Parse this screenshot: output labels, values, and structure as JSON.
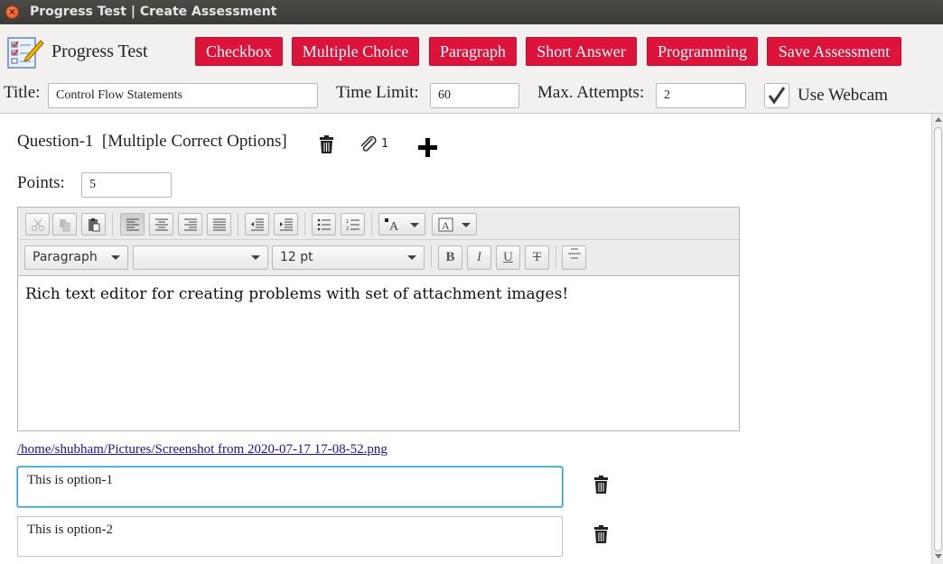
{
  "window": {
    "title": "Progress Test | Create Assessment",
    "close_glyph": "×"
  },
  "header": {
    "app_name": "Progress Test",
    "app_icon": "checklist-pencil-icon",
    "buttons": [
      "Checkbox",
      "Multiple Choice",
      "Paragraph",
      "Short Answer",
      "Programming",
      "Save Assessment"
    ],
    "accent_color": "#dc143c"
  },
  "form": {
    "title_label": "Title:",
    "title_value": "Control Flow Statements",
    "time_limit_label": "Time Limit:",
    "time_limit_value": "60",
    "max_attempts_label": "Max. Attempts:",
    "max_attempts_value": "2",
    "webcam_label": "Use Webcam",
    "webcam_checked": true
  },
  "question": {
    "heading": "Question-1  [Multiple Correct Options]",
    "attachment_count": "1",
    "points_label": "Points:",
    "points_value": "5",
    "editor": {
      "paragraph_style": "Paragraph",
      "font_family": "",
      "font_size": "12 pt",
      "body_text": "Rich text editor for creating problems with set of attachment images!"
    },
    "attachment_path": "/home/shubham/Pictures/Screenshot from 2020-07-17 17-08-52.png",
    "options": [
      {
        "text": "This is option-1"
      },
      {
        "text": "This is option-2"
      }
    ]
  }
}
